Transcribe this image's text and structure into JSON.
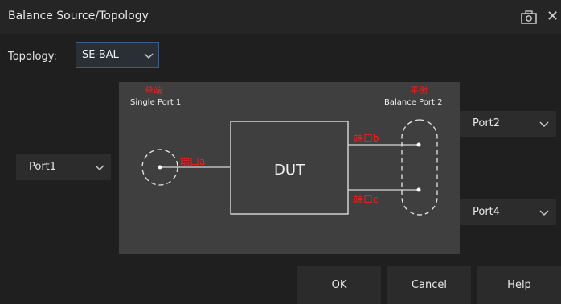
{
  "window": {
    "title": "Balance Source/Topology"
  },
  "icons": {
    "camera": "camera-icon",
    "close": "close-icon",
    "chevron": "chevron-down-icon"
  },
  "topology": {
    "label": "Topology:",
    "value": "SE-BAL"
  },
  "ports": {
    "left": "Port1",
    "right_top": "Port2",
    "right_bottom": "Port4"
  },
  "diagram": {
    "single_cn": "单端",
    "single_en": "Single Port 1",
    "balance_cn": "平衡",
    "balance_en": "Balance Port 2",
    "dut": "DUT",
    "port_a": "端口a",
    "port_b": "端口b",
    "port_c": "端口c"
  },
  "colors": {
    "accent_red": "#ff1a1a",
    "select_border": "#3a5d86"
  },
  "buttons": {
    "ok": "OK",
    "cancel": "Cancel",
    "help": "Help"
  }
}
